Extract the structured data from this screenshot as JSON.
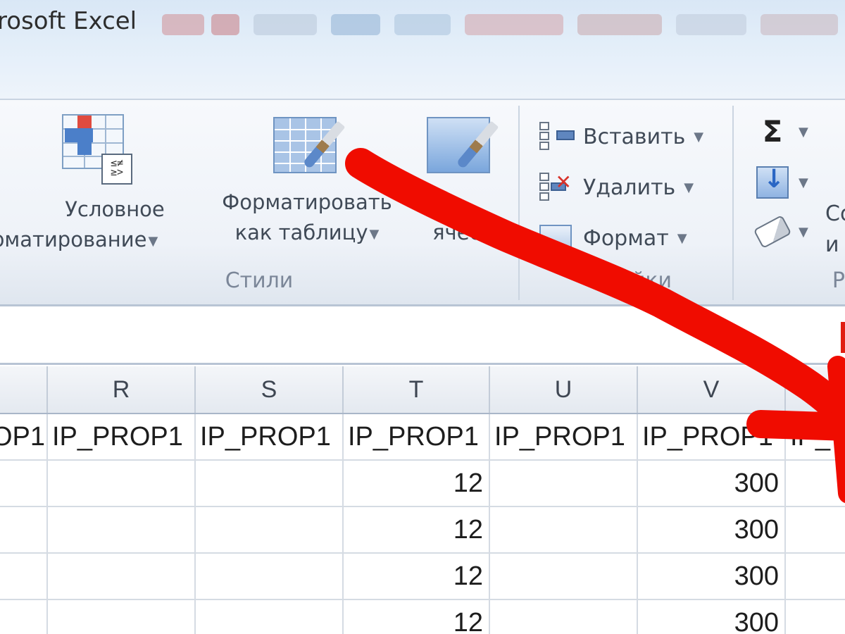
{
  "window": {
    "title": "rosoft Excel"
  },
  "ribbon": {
    "styles_group": {
      "label": "Стили",
      "conditional_formatting": {
        "line1": "Условное",
        "line2": "рматирование"
      },
      "format_as_table": {
        "line1": "Форматировать",
        "line2": "как таблицу"
      },
      "cell_styles": {
        "line1": "",
        "line2": "ячеек"
      }
    },
    "cells_group": {
      "label": "йки",
      "insert": "Вставить",
      "delete": "Удалить",
      "format": "Формат"
    },
    "editing_group": {
      "label": "Р",
      "sort_line1": "Со",
      "sort_line2": "и"
    }
  },
  "grid": {
    "columns": [
      "",
      "R",
      "S",
      "T",
      "U",
      "V",
      ""
    ],
    "header_row": [
      "OP1",
      "IP_PROP1",
      "IP_PROP1",
      "IP_PROP1",
      "IP_PROP1",
      "IP_PROP1",
      "IP_"
    ],
    "rows": [
      {
        "T": "12",
        "V": "300"
      },
      {
        "T": "12",
        "V": "300"
      },
      {
        "T": "12",
        "V": "300"
      },
      {
        "T": "12",
        "V": "300"
      }
    ]
  },
  "annotation": {
    "color": "#f00c00",
    "icon": "red-arrow-icon"
  }
}
